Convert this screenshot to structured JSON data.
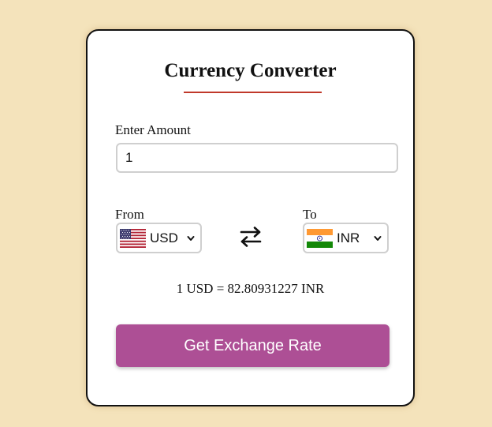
{
  "app": {
    "title": "Currency Converter"
  },
  "amount": {
    "label": "Enter Amount",
    "value": "1"
  },
  "from": {
    "label": "From",
    "currency": "USD",
    "flag": "us-flag-icon"
  },
  "to": {
    "label": "To",
    "currency": "INR",
    "flag": "india-flag-icon"
  },
  "swap": {
    "icon": "swap-arrows-icon"
  },
  "rate": {
    "text": "1 USD = 82.80931227 INR"
  },
  "button": {
    "label": "Get Exchange Rate"
  },
  "colors": {
    "background": "#f4e3bb",
    "accent_underline": "#c0392b",
    "button": "#ad4f95",
    "card_border": "#111111"
  }
}
